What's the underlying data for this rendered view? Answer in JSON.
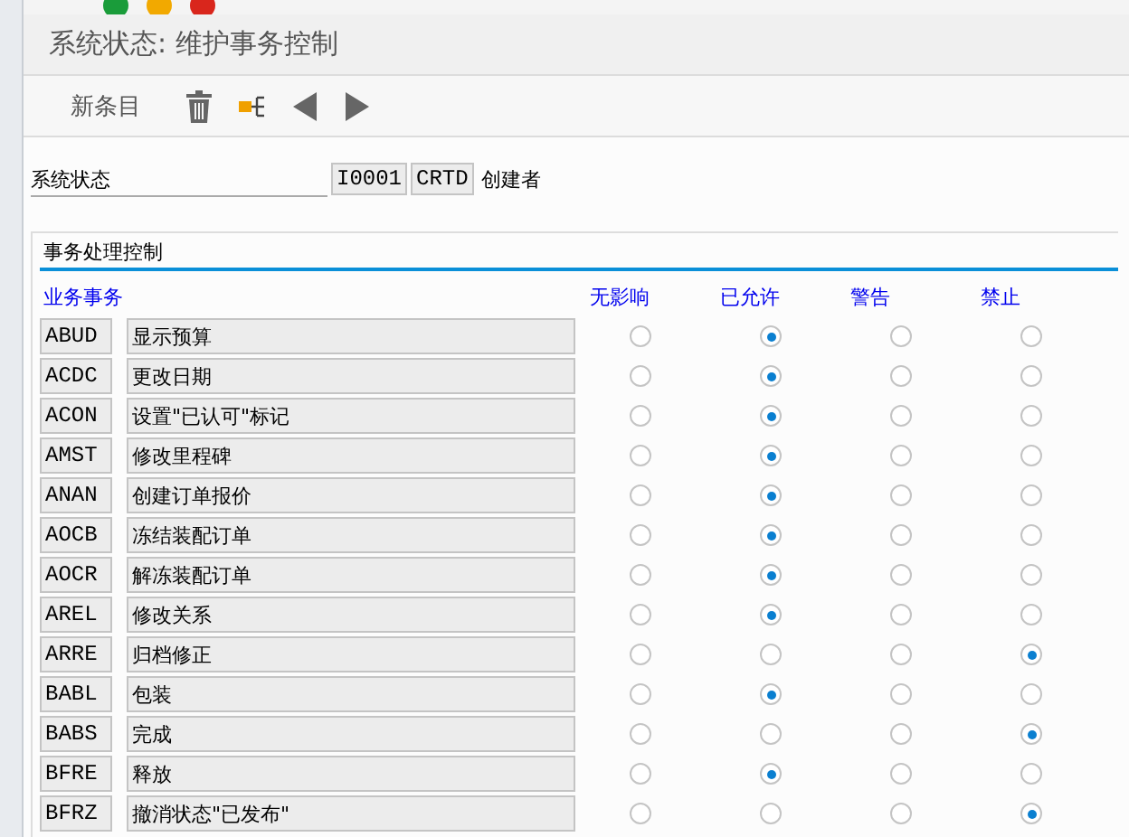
{
  "window": {
    "title": "系统状态: 维护事务控制"
  },
  "toolbar": {
    "new_entry": "新条目"
  },
  "status": {
    "label": "系统状态",
    "code": "I0001",
    "short": "CRTD",
    "text": "创建者"
  },
  "group": {
    "title": "事务处理控制",
    "columns": [
      "业务事务",
      "无影响",
      "已允许",
      "警告",
      "禁止"
    ],
    "rows": [
      {
        "code": "ABUD",
        "text": "显示预算",
        "options": [
          {
            "selected": false
          },
          {
            "selected": true
          },
          {
            "selected": false
          },
          {
            "selected": false
          }
        ]
      },
      {
        "code": "ACDC",
        "text": "更改日期",
        "options": [
          {
            "selected": false
          },
          {
            "selected": true
          },
          {
            "selected": false
          },
          {
            "selected": false
          }
        ]
      },
      {
        "code": "ACON",
        "text": "设置\"已认可\"标记",
        "options": [
          {
            "selected": false
          },
          {
            "selected": true
          },
          {
            "selected": false
          },
          {
            "selected": false
          }
        ]
      },
      {
        "code": "AMST",
        "text": "修改里程碑",
        "options": [
          {
            "selected": false
          },
          {
            "selected": true
          },
          {
            "selected": false
          },
          {
            "selected": false
          }
        ]
      },
      {
        "code": "ANAN",
        "text": "创建订单报价",
        "options": [
          {
            "selected": false
          },
          {
            "selected": true
          },
          {
            "selected": false
          },
          {
            "selected": false
          }
        ]
      },
      {
        "code": "AOCB",
        "text": "冻结装配订单",
        "options": [
          {
            "selected": false
          },
          {
            "selected": true
          },
          {
            "selected": false
          },
          {
            "selected": false
          }
        ]
      },
      {
        "code": "AOCR",
        "text": "解冻装配订单",
        "options": [
          {
            "selected": false
          },
          {
            "selected": true
          },
          {
            "selected": false
          },
          {
            "selected": false
          }
        ]
      },
      {
        "code": "AREL",
        "text": "修改关系",
        "options": [
          {
            "selected": false
          },
          {
            "selected": true
          },
          {
            "selected": false
          },
          {
            "selected": false
          }
        ]
      },
      {
        "code": "ARRE",
        "text": "归档修正",
        "options": [
          {
            "selected": false
          },
          {
            "selected": false
          },
          {
            "selected": false
          },
          {
            "selected": true
          }
        ]
      },
      {
        "code": "BABL",
        "text": "包装",
        "options": [
          {
            "selected": false
          },
          {
            "selected": true
          },
          {
            "selected": false
          },
          {
            "selected": false
          }
        ]
      },
      {
        "code": "BABS",
        "text": "完成",
        "options": [
          {
            "selected": false
          },
          {
            "selected": false
          },
          {
            "selected": false
          },
          {
            "selected": true
          }
        ]
      },
      {
        "code": "BFRE",
        "text": "释放",
        "options": [
          {
            "selected": false
          },
          {
            "selected": true
          },
          {
            "selected": false
          },
          {
            "selected": false
          }
        ]
      },
      {
        "code": "BFRZ",
        "text": "撤消状态\"已发布\"",
        "options": [
          {
            "selected": false
          },
          {
            "selected": false
          },
          {
            "selected": false
          },
          {
            "selected": true
          }
        ]
      }
    ]
  }
}
